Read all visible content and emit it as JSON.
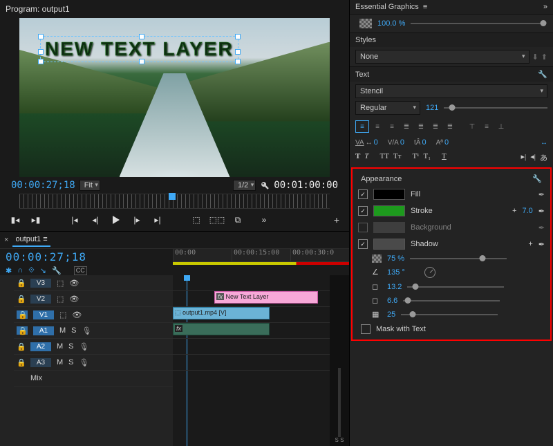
{
  "program": {
    "title": "Program: output1",
    "overlay_text": "NEW TEXT LAYER",
    "timecode_current": "00:00:27;18",
    "timecode_duration": "00:01:00:00",
    "fit_label": "Fit",
    "zoom_label": "1/2"
  },
  "timeline": {
    "tab": "output1",
    "timecode": "00:00:27;18",
    "time_marks": [
      "00:00",
      "00:00:15:00",
      "00:00:30:0"
    ],
    "tracks": {
      "v3": "V3",
      "v2": "V2",
      "v1": "V1",
      "a1": "A1",
      "a2": "A2",
      "a3": "A3",
      "mix": "Mix"
    },
    "audio_m": "M",
    "audio_s": "S",
    "clip_v2_label": "New Text Layer",
    "clip_v2_fx": "fx",
    "clip_v1_label": "output1.mp4 [V]",
    "clip_a_fx": "fx",
    "meter_label": "S S"
  },
  "essential_graphics": {
    "title": "Essential Graphics",
    "opacity_value": "100.0 %",
    "styles_label": "Styles",
    "style_value": "None",
    "text_label": "Text",
    "font_family": "Stencil",
    "font_weight": "Regular",
    "font_size": "121",
    "metrics": {
      "va1": "0",
      "va2": "0",
      "tracking": "0",
      "baseline": "0"
    }
  },
  "appearance": {
    "title": "Appearance",
    "fill_label": "Fill",
    "fill_color": "#000000",
    "stroke_label": "Stroke",
    "stroke_color": "#1d9a1d",
    "stroke_value": "7.0",
    "background_label": "Background",
    "bg_color": "#555555",
    "shadow_label": "Shadow",
    "shadow_color": "#4a4a4a",
    "shadow_opacity": "75 %",
    "shadow_angle": "135 °",
    "shadow_distance": "13.2",
    "shadow_size": "6.6",
    "shadow_blur": "25",
    "mask_label": "Mask with Text",
    "plus": "+"
  }
}
